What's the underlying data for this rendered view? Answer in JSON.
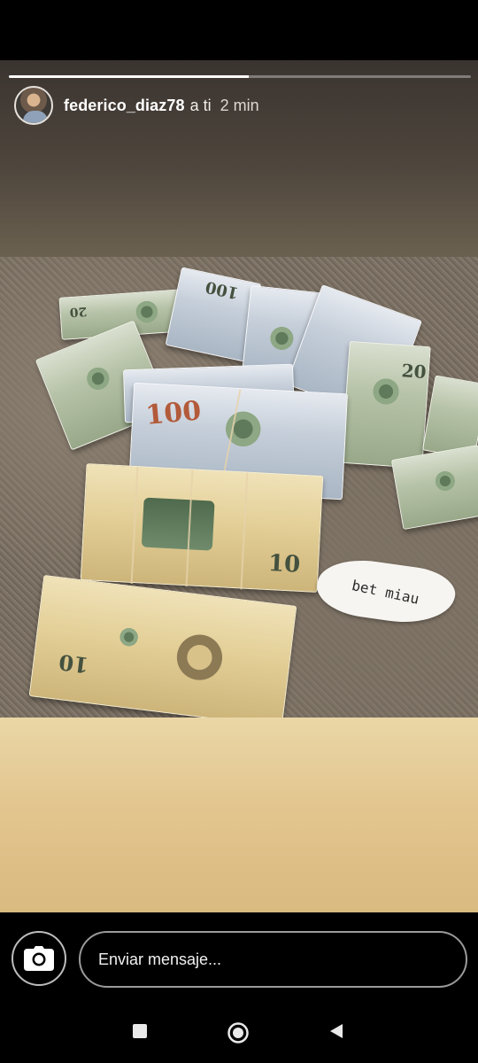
{
  "story": {
    "progress": 0.52,
    "username": "federico_diaz78",
    "recipient": "a ti",
    "time": "2 min"
  },
  "photo": {
    "handwritten_note": "bet miau",
    "denominations": [
      "100",
      "100",
      "20",
      "20",
      "10",
      "10"
    ]
  },
  "reply": {
    "placeholder": "Enviar mensaje..."
  },
  "icons": {
    "camera": "camera-icon",
    "recent": "square-icon",
    "home": "circle-icon",
    "back": "triangle-icon"
  },
  "colors": {
    "background": "#000000",
    "input_border": "#9a9a9a",
    "bottom_gradient": "#e2c48d"
  }
}
